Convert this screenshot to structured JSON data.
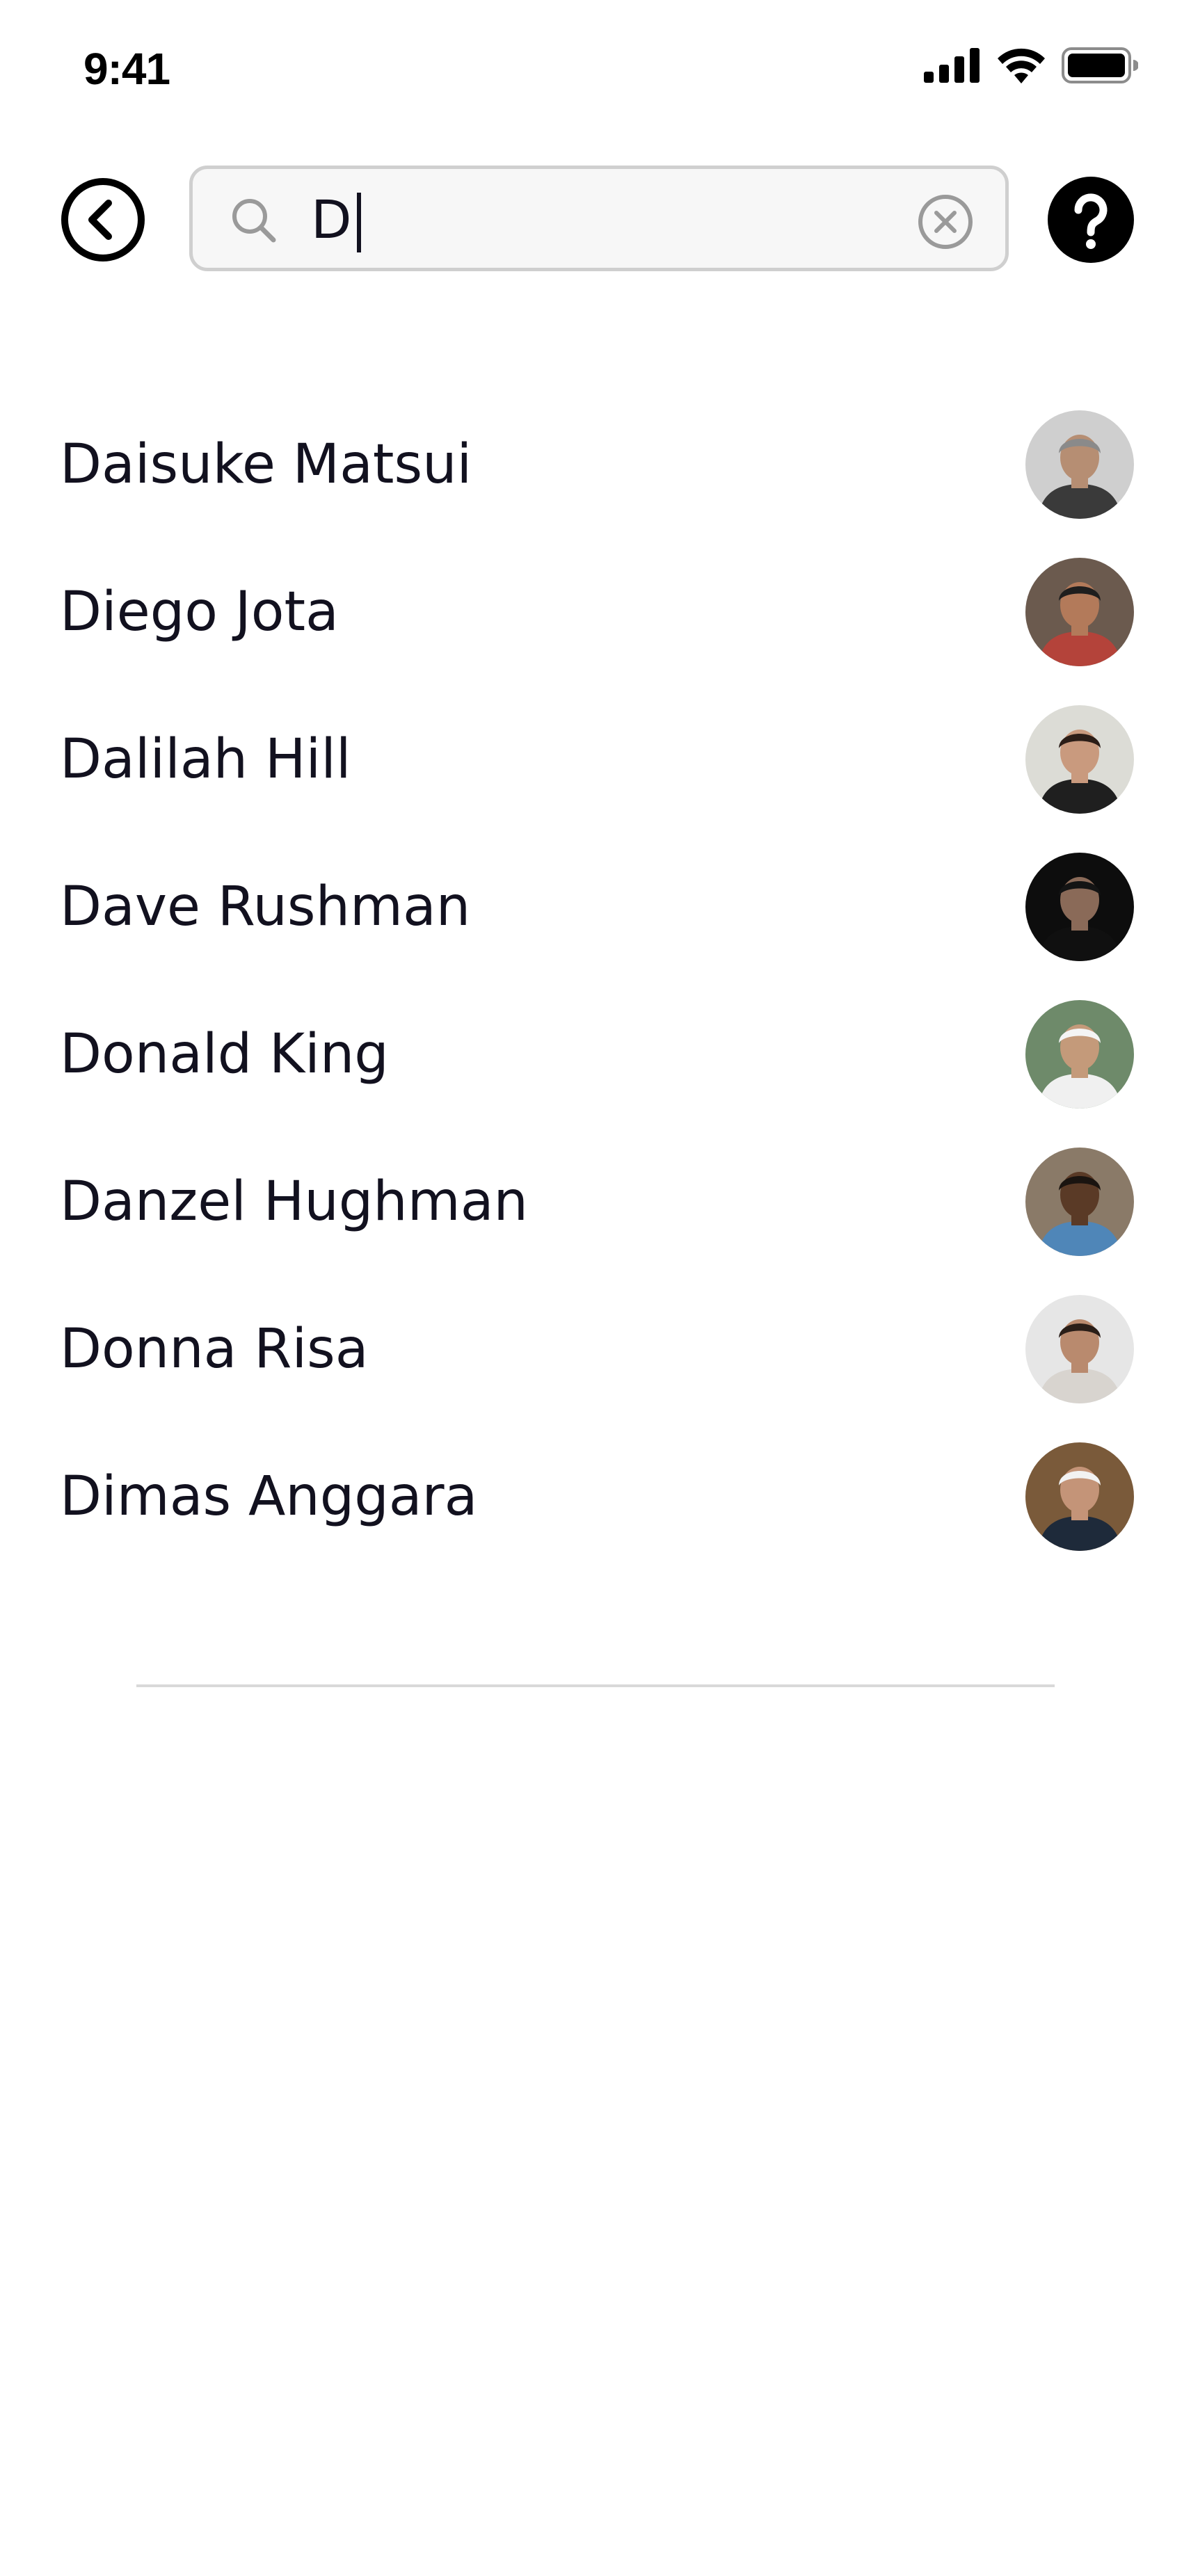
{
  "status_bar": {
    "time": "9:41",
    "icons": [
      "cellular-signal-icon",
      "wifi-icon",
      "battery-icon"
    ]
  },
  "header": {
    "back_icon": "chevron-left-circle-icon",
    "help_icon": "question-mark-circle-icon"
  },
  "search": {
    "value": "D",
    "search_icon": "search-icon",
    "clear_icon": "clear-x-circle-icon"
  },
  "results": [
    {
      "name": "Daisuke Matsui",
      "avatar": {
        "bg": "#cfcfcf",
        "skin": "#b68e73",
        "hair": "#8a8a8a",
        "shirt": "#3a3a3a"
      }
    },
    {
      "name": "Diego Jota",
      "avatar": {
        "bg": "#6b5a4e",
        "skin": "#b37a5a",
        "hair": "#1e1e1e",
        "shirt": "#b4433a"
      }
    },
    {
      "name": "Dalilah Hill",
      "avatar": {
        "bg": "#dcdcd6",
        "skin": "#c99a7e",
        "hair": "#2b1d17",
        "shirt": "#1f1f1f"
      }
    },
    {
      "name": "Dave Rushman",
      "avatar": {
        "bg": "#0d0d0d",
        "skin": "#8a6a58",
        "hair": "#141414",
        "shirt": "#101010"
      }
    },
    {
      "name": "Donald King",
      "avatar": {
        "bg": "#6e8a6a",
        "skin": "#c49a7a",
        "hair": "#f4f4f4",
        "shirt": "#f0f0f0"
      }
    },
    {
      "name": "Danzel Hughman",
      "avatar": {
        "bg": "#8a7a68",
        "skin": "#5a3a26",
        "hair": "#1a1410",
        "shirt": "#4f86b8"
      }
    },
    {
      "name": "Donna Risa",
      "avatar": {
        "bg": "#e6e6e6",
        "skin": "#b98a6e",
        "hair": "#2a1e18",
        "shirt": "#d8d4cf"
      }
    },
    {
      "name": "Dimas Anggara",
      "avatar": {
        "bg": "#7a5a3a",
        "skin": "#c49478",
        "hair": "#f2f2f2",
        "shirt": "#1e2a3a"
      }
    }
  ],
  "colors": {
    "text": "#12111f",
    "search_border": "#cfcfcf",
    "search_bg": "#f7f7f7",
    "icon_gray": "#9a9a9a",
    "divider": "#d9d9d9"
  }
}
